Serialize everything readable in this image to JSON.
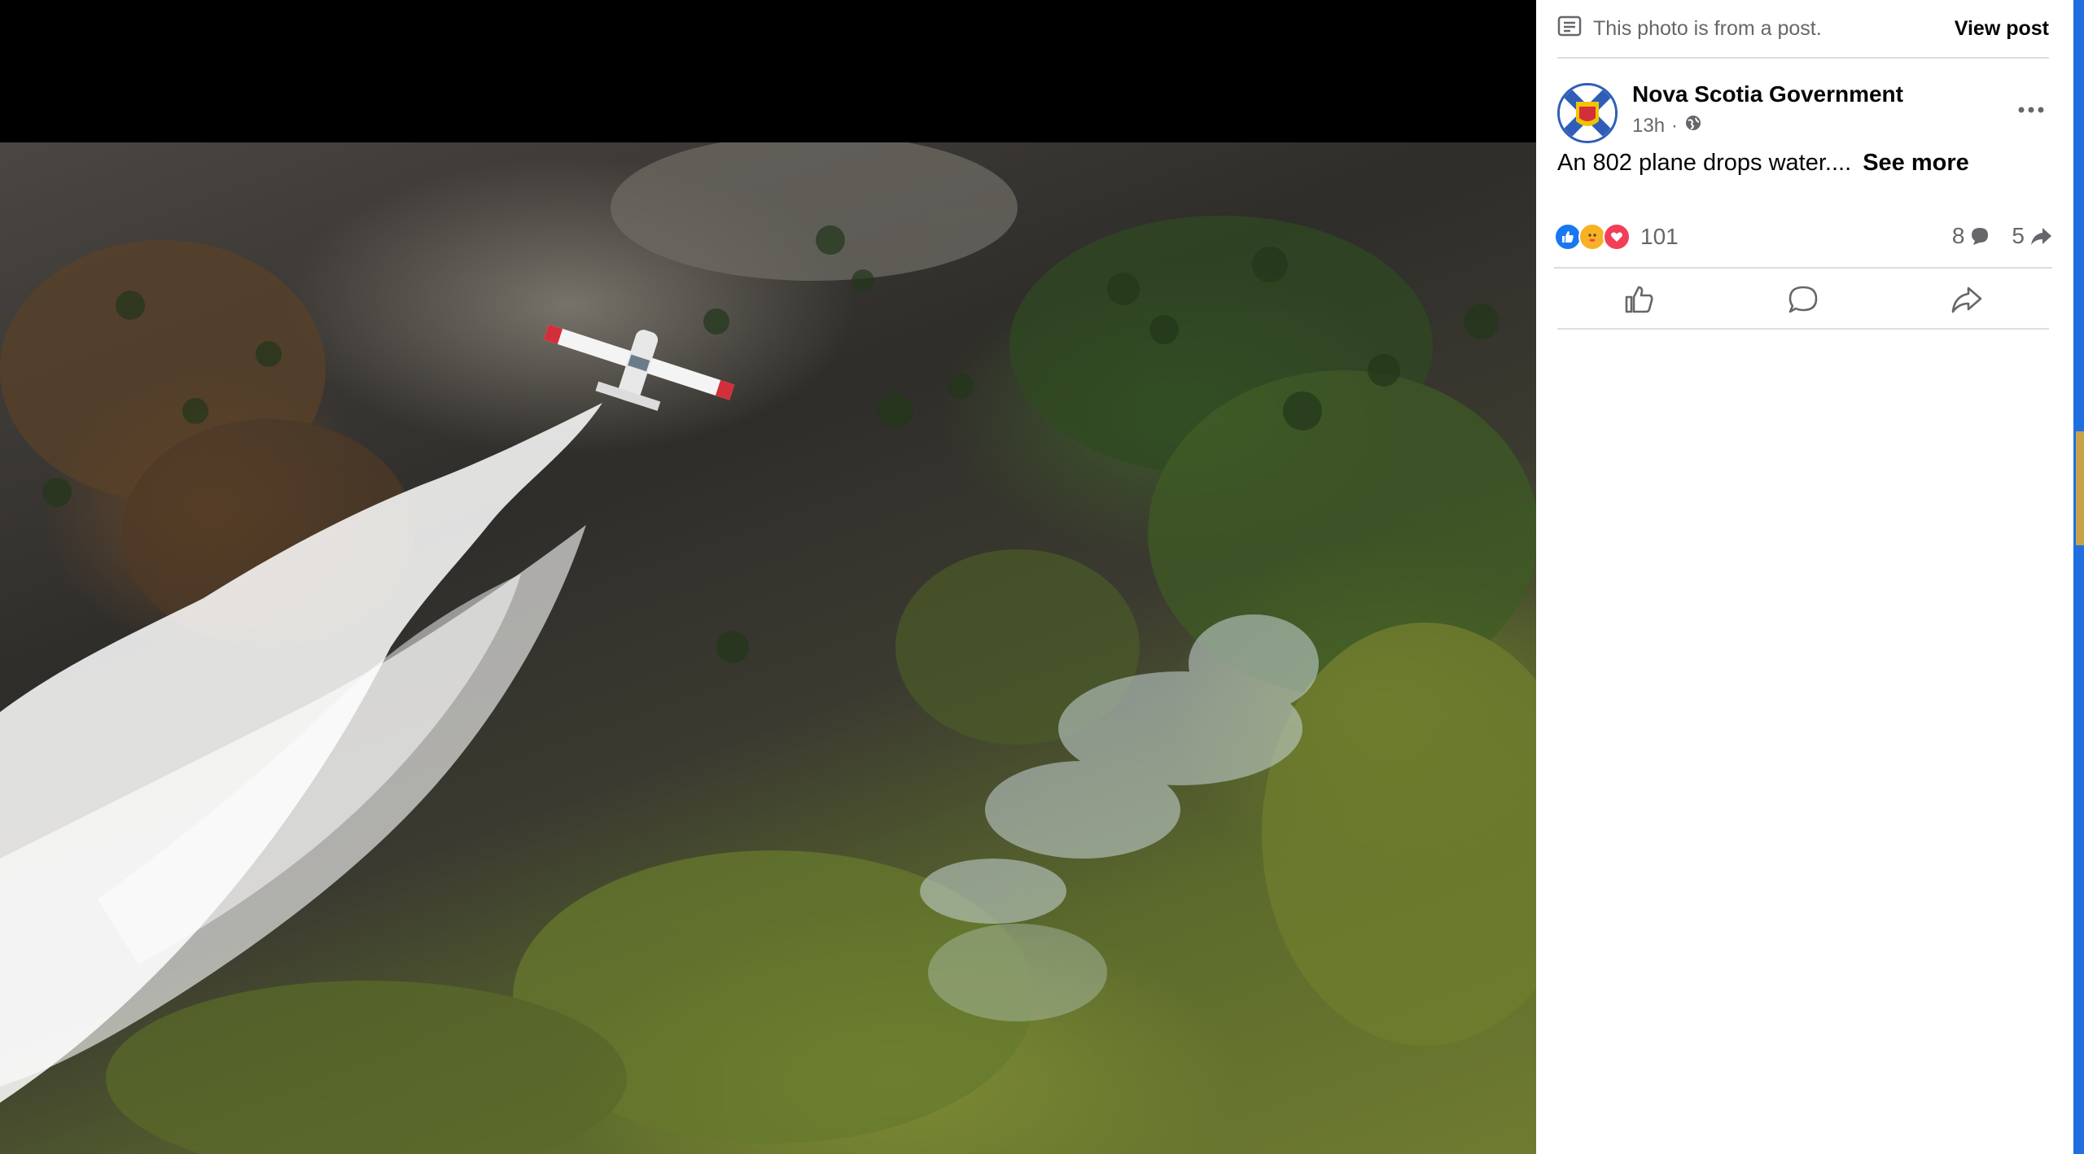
{
  "post_notice": {
    "text": "This photo is from a post.",
    "view_post_label": "View post",
    "icon": "post-icon"
  },
  "post": {
    "page_name": "Nova Scotia Government",
    "time": "13h",
    "separator": "·",
    "audience_icon": "globe-icon",
    "caption": "An 802 plane drops water....",
    "see_more_label": "See more",
    "more_icon": "more-options-icon"
  },
  "stats": {
    "reaction_icons": [
      "like-reaction-icon",
      "care-reaction-icon",
      "love-reaction-icon"
    ],
    "reaction_count": "101",
    "comment_count": "8",
    "share_count": "5"
  },
  "actions": [
    {
      "name": "like-button",
      "icon": "thumbs-up-icon"
    },
    {
      "name": "comment-button",
      "icon": "comment-icon"
    },
    {
      "name": "share-button",
      "icon": "share-icon"
    }
  ],
  "colors": {
    "like_blue": "#1877f2",
    "love_red": "#f33e58",
    "care_yellow": "#f7b125",
    "secondary_text": "#65676b",
    "primary_text": "#050505"
  }
}
